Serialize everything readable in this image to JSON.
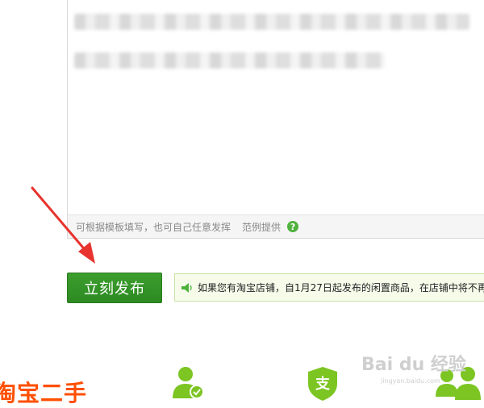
{
  "editor": {
    "hint_text": "可根据模板填写，也可自己任意发挥",
    "example_link": "范例提供",
    "help_icon": "?"
  },
  "publish": {
    "label": "立刻发布"
  },
  "notice": {
    "icon": "speaker-icon",
    "text": "如果您有淘宝店铺，自1月27日起发布的闲置商品，在店铺中将不再"
  },
  "footer": {
    "brand": "淘宝二手",
    "support_icon_text": "支"
  },
  "watermark": {
    "text": "Bai du 经验",
    "url": "jingyan.baidu.com"
  },
  "colors": {
    "publish_green": "#2d8a22",
    "notice_bg": "#f6fbea",
    "brand_orange": "#ff4f00",
    "icon_green": "#7cc522"
  }
}
